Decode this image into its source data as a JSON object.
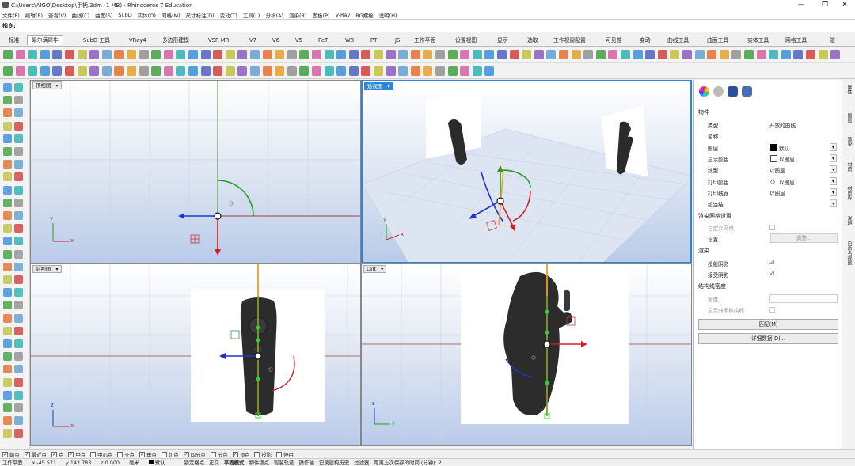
{
  "app": {
    "title": "C:\\Users\\AIGO\\Desktop\\手柄.3dm (1 MB) - Rhinoceros 7 Education",
    "window_controls": [
      "—",
      "❐",
      "✕"
    ]
  },
  "menu": [
    "文件(F)",
    "编辑(E)",
    "查看(V)",
    "曲线(C)",
    "曲面(S)",
    "SubD",
    "实体(O)",
    "网格(M)",
    "尺寸标注(D)",
    "变动(T)",
    "工具(L)",
    "分析(A)",
    "渲染(R)",
    "面板(P)",
    "V-Ray",
    "BG螺栓",
    "说明(H)"
  ],
  "command": {
    "label": "指令:",
    "value": ""
  },
  "tabs": [
    "标准",
    "犀尔满犀牛",
    "SubD 工具",
    "VRay4",
    "多边形建模",
    "VSR-MR",
    "V7",
    "V6",
    "V5",
    "PeT",
    "W8",
    "PT",
    "JS",
    "工作平面",
    "设置视图",
    "显示",
    "选取",
    "工作视窗配置",
    "可见性",
    "变动",
    "曲线工具",
    "曲面工具",
    "实体工具",
    "网格工具",
    "渲"
  ],
  "active_tab": "犀尔满犀牛",
  "viewports": {
    "top": {
      "title": "顶视图"
    },
    "perspective": {
      "title": "透视图"
    },
    "front": {
      "title": "前视图"
    },
    "left": {
      "title": "Left"
    }
  },
  "axis": {
    "x": "x",
    "y": "y",
    "z": "z"
  },
  "properties": {
    "section_object": "物件",
    "rows": [
      {
        "key": "类型",
        "value": "开放的曲线",
        "dropdown": false
      },
      {
        "key": "名称",
        "value": "",
        "dropdown": false
      },
      {
        "key": "图层",
        "value": "默认",
        "dropdown": true
      },
      {
        "key": "显示颜色",
        "value": "以图层",
        "dropdown": true
      },
      {
        "key": "线型",
        "value": "以图层",
        "dropdown": true
      },
      {
        "key": "打印颜色",
        "value": "以图层",
        "dropdown": true
      },
      {
        "key": "打印线宽",
        "value": "以图层",
        "dropdown": true
      },
      {
        "key": "超连结",
        "value": "",
        "dropdown": true
      }
    ],
    "section_mesh": "渲染网格设置",
    "mesh_rows": [
      {
        "key": "自定义网格",
        "value": ""
      },
      {
        "key": "设置",
        "value": "调整..."
      }
    ],
    "section_render": "渲染",
    "render_rows": [
      {
        "key": "投射阴影",
        "value": "☑"
      },
      {
        "key": "接受阴影",
        "value": "☑"
      }
    ],
    "section_iso": "结构线密度",
    "iso_rows": [
      {
        "key": "密度",
        "value": ""
      },
      {
        "key": "显示曲面结构线",
        "value": ""
      }
    ],
    "match_button": "匹配(M)",
    "details_button": "详细数据(D)..."
  },
  "right_tabs": [
    "属性",
    "图层",
    "渲染",
    "材质",
    "材质库",
    "说明",
    "已命名视图"
  ],
  "snaps": [
    {
      "label": "端点",
      "checked": true
    },
    {
      "label": "最近点",
      "checked": true
    },
    {
      "label": "点",
      "checked": true
    },
    {
      "label": "中点",
      "checked": true
    },
    {
      "label": "中心点",
      "checked": false
    },
    {
      "label": "交点",
      "checked": false
    },
    {
      "label": "垂点",
      "checked": true
    },
    {
      "label": "切点",
      "checked": false
    },
    {
      "label": "四分点",
      "checked": true
    },
    {
      "label": "节点",
      "checked": false
    },
    {
      "label": "顶点",
      "checked": true
    },
    {
      "label": "投影",
      "checked": false
    },
    {
      "label": "停用",
      "checked": false
    }
  ],
  "status": {
    "cplane": "工作平面",
    "x": "x -45.571",
    "y": "y 142.783",
    "z": "z 0.000",
    "unit": "毫米",
    "layer": "默认",
    "items": [
      "锁定格点",
      "正交",
      "平面模式",
      "物件锁点",
      "智慧轨迹",
      "操作轴",
      "记录建构历史",
      "过滤器",
      "距离上次保存的时间 (分钟): 2"
    ]
  }
}
